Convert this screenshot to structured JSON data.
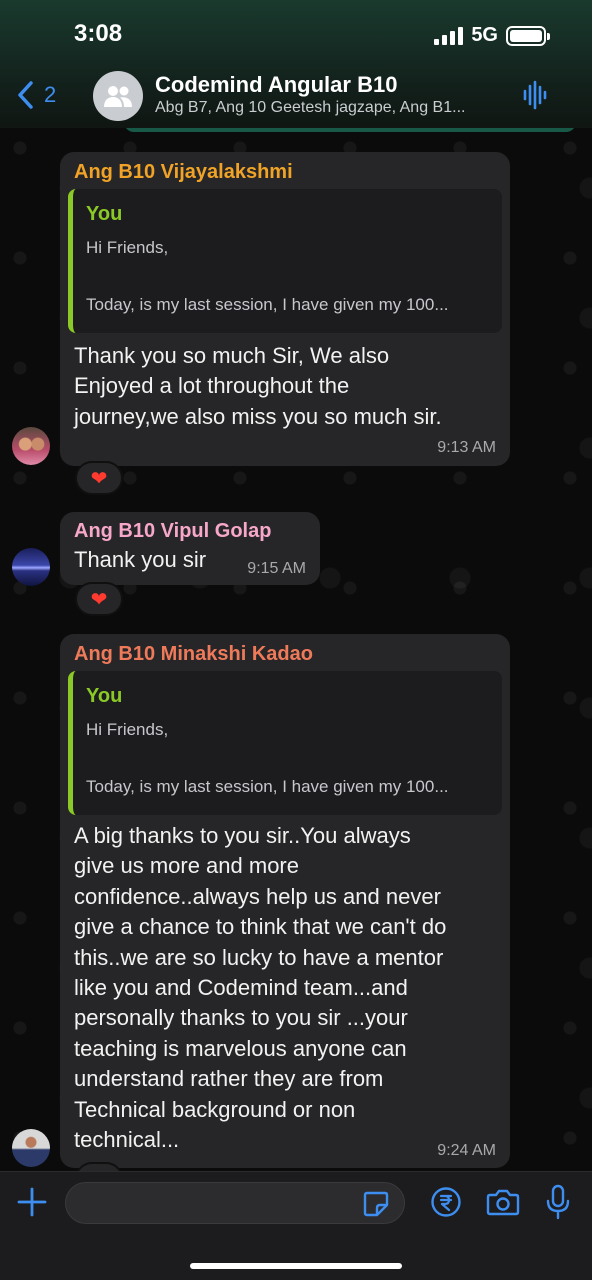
{
  "status": {
    "time": "3:08",
    "network": "5G"
  },
  "header": {
    "back_count": "2",
    "title": "Codemind Angular B10",
    "subtitle": "Abg B7, Ang 10 Geetesh jagzape, Ang B1..."
  },
  "messages": [
    {
      "sender": "Ang B10 Vijayalakshmi",
      "sender_color": "#f0a326",
      "quote": {
        "author": "You",
        "line1": "Hi Friends,",
        "line2": "Today, is my last session, I have given my 100..."
      },
      "lines": [
        "Thank you so much Sir, We also",
        "Enjoyed a lot throughout the",
        "journey,we also miss you so much sir."
      ],
      "time": "9:13 AM",
      "reaction": "❤"
    },
    {
      "sender": "Ang B10 Vipul Golap",
      "sender_color": "#f7a8c8",
      "lines": [
        "Thank you sir"
      ],
      "time": "9:15 AM",
      "reaction": "❤"
    },
    {
      "sender": "Ang B10 Minakshi Kadao",
      "sender_color": "#ef7a5a",
      "quote": {
        "author": "You",
        "line1": "Hi Friends,",
        "line2": "Today, is my last session, I have given my 100..."
      },
      "lines": [
        "A big thanks to you sir..You always",
        "give us more and more",
        "confidence..always help us and never",
        "give a chance to think that we can't do",
        "this..we are so lucky to have a mentor",
        "like you and Codemind team...and",
        "personally thanks to you sir ...your",
        "teaching is marvelous anyone can",
        "understand rather they are from",
        "Technical background or non",
        "technical..."
      ],
      "time": "9:24 AM",
      "reaction": "❤"
    }
  ],
  "composer": {
    "value": ""
  },
  "colors": {
    "accent": "#3d8ef0",
    "quote_bar": "#8ac926",
    "bubble": "#262628",
    "reaction": "#ff3b30"
  }
}
